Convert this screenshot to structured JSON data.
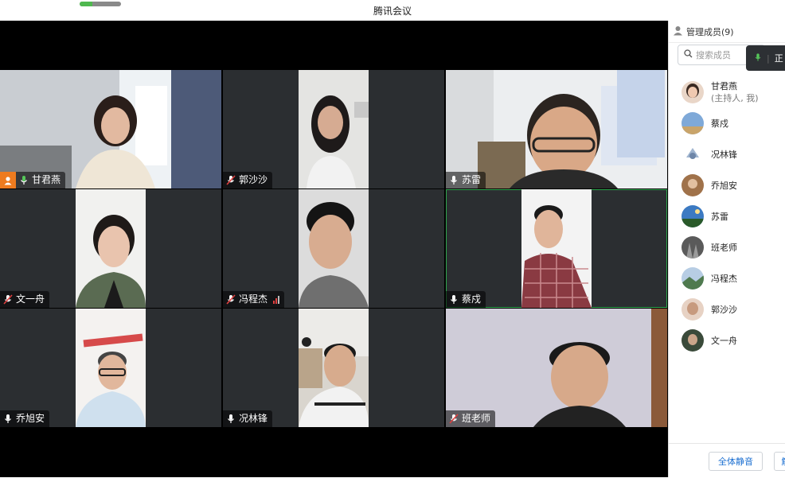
{
  "window": {
    "title": "腾讯会议",
    "loading_progress": 0.3
  },
  "tiles": [
    {
      "name": "甘君燕",
      "host": true,
      "muted": false,
      "active": false,
      "video": "full"
    },
    {
      "name": "郭沙沙",
      "host": false,
      "muted": true,
      "active": false,
      "video": "portrait"
    },
    {
      "name": "苏雷",
      "host": false,
      "muted": false,
      "active": false,
      "video": "full"
    },
    {
      "name": "文一舟",
      "host": false,
      "muted": true,
      "active": false,
      "video": "portrait"
    },
    {
      "name": "冯程杰",
      "host": false,
      "muted": true,
      "active": false,
      "video": "portrait",
      "signal": "weak"
    },
    {
      "name": "蔡戍",
      "host": false,
      "muted": false,
      "active": true,
      "video": "portrait"
    },
    {
      "name": "乔旭安",
      "host": false,
      "muted": false,
      "active": false,
      "video": "portrait"
    },
    {
      "name": "况林锋",
      "host": false,
      "muted": false,
      "active": false,
      "video": "portrait"
    },
    {
      "name": "班老师",
      "host": false,
      "muted": true,
      "active": false,
      "video": "full"
    }
  ],
  "panel": {
    "title": "管理成员(9)",
    "search_placeholder": "搜索成员",
    "speaking_label": "正",
    "members": [
      {
        "name": "甘君燕",
        "sub": "(主持人, 我)"
      },
      {
        "name": "蔡戍"
      },
      {
        "name": "况林锋"
      },
      {
        "name": "乔旭安"
      },
      {
        "name": "苏雷"
      },
      {
        "name": "班老师"
      },
      {
        "name": "冯程杰"
      },
      {
        "name": "郭沙沙"
      },
      {
        "name": "文一舟"
      }
    ],
    "mute_all_label": "全体静音",
    "unmute_all_label": "解"
  },
  "colors": {
    "accent": "#1b6fd1",
    "active_border": "#2fa84f",
    "host_badge": "#ee7b1f",
    "muted_mic": "#e04040"
  }
}
